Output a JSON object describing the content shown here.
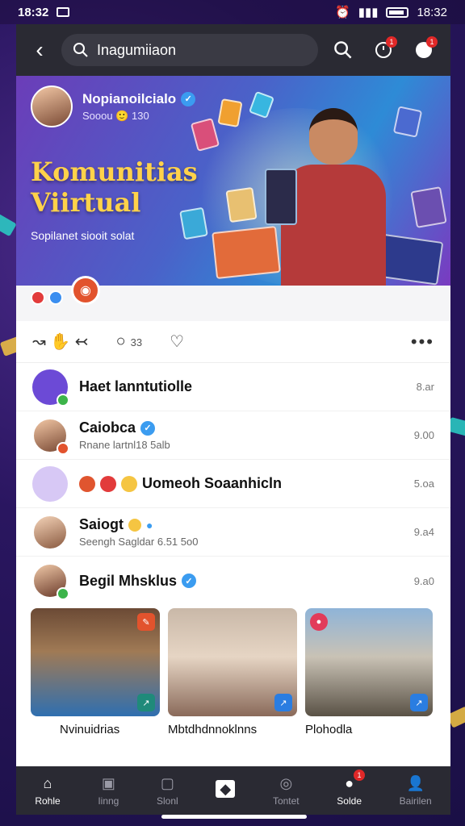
{
  "status_bar": {
    "time": "18:32",
    "time_right": "18:32"
  },
  "top_bar": {
    "search_text": "Inagumiiaon",
    "notif_badge_1": "1",
    "notif_badge_2": "1"
  },
  "banner": {
    "profile_name": "Nopianoilcialo",
    "profile_sub": "Sooou 🙂 130",
    "title_line1": "Komunitias",
    "title_line2": "Viirtual",
    "subtitle": "Sopilanet siooit solat"
  },
  "actions": {
    "comments_count": "33"
  },
  "list": [
    {
      "title": "Haet lanntutiolle",
      "subtitle": "",
      "time": "8.ar"
    },
    {
      "title": "Caiobca",
      "subtitle": "Rnane lartnl18 5alb",
      "time": "9.00"
    },
    {
      "title": "Uomeoh Soaanhicln",
      "subtitle": "",
      "time": "5.oa"
    },
    {
      "title": "Saiogt",
      "subtitle": "Seengh Sagldar 6.51 5o0",
      "time": "9.a4"
    },
    {
      "title": "Begil Mhsklus",
      "subtitle": "",
      "time": "9.a0"
    }
  ],
  "gallery_captions": [
    "Nvinuidrias",
    "Mbtdhdnnoklnns",
    "Plohodla"
  ],
  "bottom_nav": [
    {
      "label": "Rohle",
      "icon": "home-icon",
      "active": true
    },
    {
      "label": "Iinng",
      "icon": "chat-icon",
      "active": false
    },
    {
      "label": "Slonl",
      "icon": "tv-icon",
      "active": false
    },
    {
      "label": "",
      "icon": "create-icon",
      "active": false
    },
    {
      "label": "Tontet",
      "icon": "target-icon",
      "active": false
    },
    {
      "label": "Solde",
      "icon": "message-icon",
      "active": false,
      "badge": "1"
    },
    {
      "label": "Bairilen",
      "icon": "profile-icon",
      "active": false
    }
  ]
}
